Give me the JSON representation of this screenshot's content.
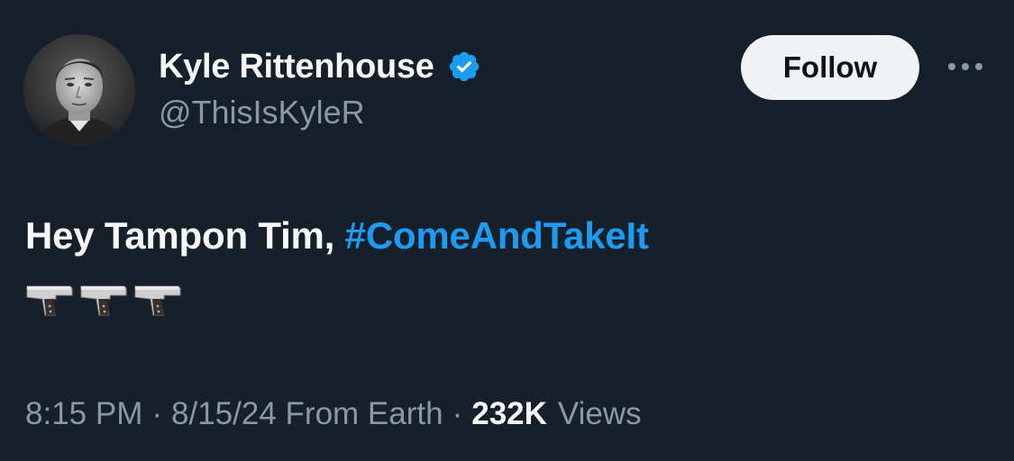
{
  "author": {
    "display_name": "Kyle Rittenhouse",
    "handle": "@ThisIsKyleR",
    "verified_icon": "verified-badge-icon",
    "avatar_icon": "profile-photo"
  },
  "actions": {
    "follow_label": "Follow",
    "more_icon": "more-options-icon"
  },
  "tweet": {
    "text": "Hey Tampon Tim, ",
    "hashtag": "#ComeAndTakeIt",
    "emojis": [
      "pistol-emoji",
      "pistol-emoji",
      "pistol-emoji"
    ]
  },
  "meta": {
    "time": "8:15 PM",
    "separator": "·",
    "date": "8/15/24",
    "location": "From Earth",
    "views_count": "232K",
    "views_label": "Views"
  },
  "colors": {
    "background": "#15202b",
    "accent": "#1d9bf0",
    "secondary_text": "#8b98a5",
    "primary_text": "#f7f9f9"
  }
}
